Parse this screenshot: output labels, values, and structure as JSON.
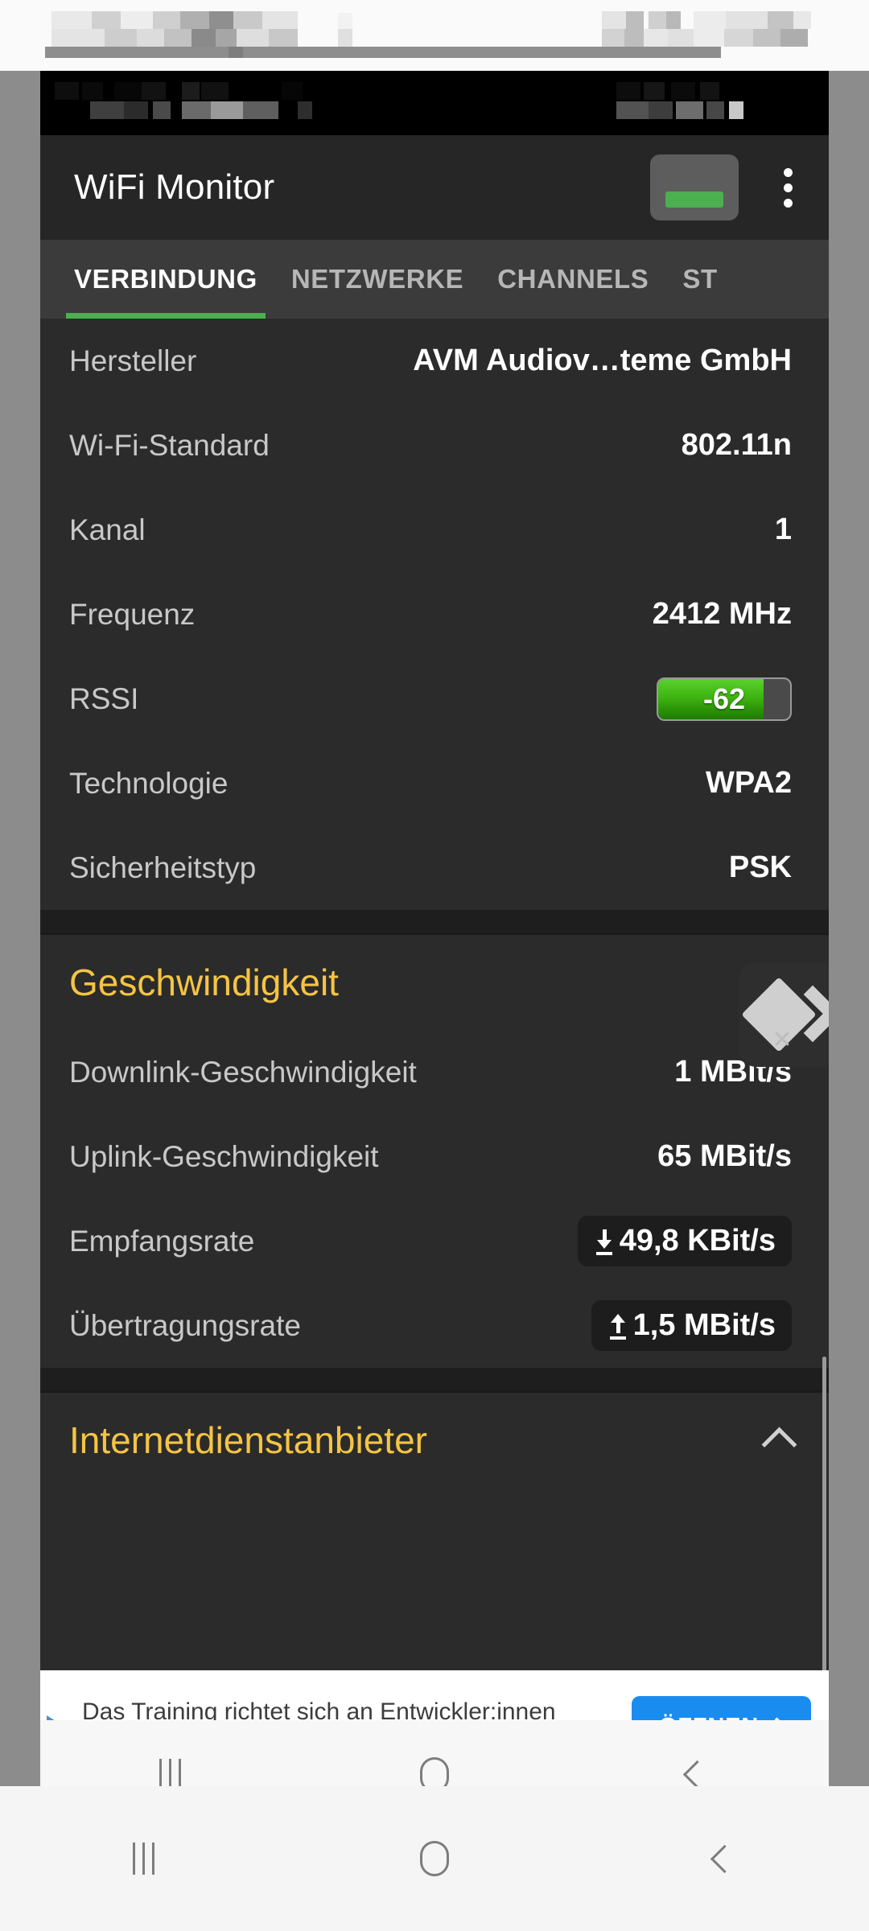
{
  "app": {
    "title": "WiFi Monitor",
    "toggle_state": "on",
    "overflow_icon": "kebab-menu-icon"
  },
  "tabs": [
    {
      "label": "VERBINDUNG",
      "active": true
    },
    {
      "label": "NETZWERKE",
      "active": false
    },
    {
      "label": "CHANNELS",
      "active": false
    },
    {
      "label": "ST",
      "active": false
    }
  ],
  "connection": {
    "rows": [
      {
        "label": "Hersteller",
        "value": "AVM Audiov…teme GmbH"
      },
      {
        "label": "Wi-Fi-Standard",
        "value": "802.11n"
      },
      {
        "label": "Kanal",
        "value": "1"
      },
      {
        "label": "Frequenz",
        "value": "2412 MHz"
      }
    ],
    "rssi": {
      "label": "RSSI",
      "value": "-62",
      "fill_percent": 80
    },
    "rows_after": [
      {
        "label": "Technologie",
        "value": "WPA2"
      },
      {
        "label": "Sicherheitstyp",
        "value": "PSK"
      }
    ]
  },
  "speed": {
    "title": "Geschwindigkeit",
    "rows": [
      {
        "label": "Downlink-Geschwindigkeit",
        "value": "1 MBit/s"
      },
      {
        "label": "Uplink-Geschwindigkeit",
        "value": "65 MBit/s"
      }
    ],
    "rates": [
      {
        "label": "Empfangsrate",
        "value": "49,8 KBit/s",
        "icon": "download-arrow-icon"
      },
      {
        "label": "Übertragungsrate",
        "value": "1,5 MBit/s",
        "icon": "upload-arrow-icon"
      }
    ]
  },
  "isp": {
    "title": "Internetdienstanbieter",
    "expanded": true
  },
  "ad": {
    "body": "Das Training richtet sich an Entwickler:innen und Administrator:innen.",
    "cta": "ÖFFNEN",
    "choices_icon": "ad-choices-icon",
    "close_icon": "ad-close-icon"
  },
  "navbar": {
    "recents": "recents-icon",
    "home": "home-icon",
    "back": "back-icon"
  },
  "colors": {
    "accent_green": "#4caf50",
    "section_yellow": "#f5c443",
    "cta_blue": "#1a8cf0",
    "surface": "#2b2b2b",
    "appbar": "#262626",
    "tabbar": "#3b3b3b"
  }
}
